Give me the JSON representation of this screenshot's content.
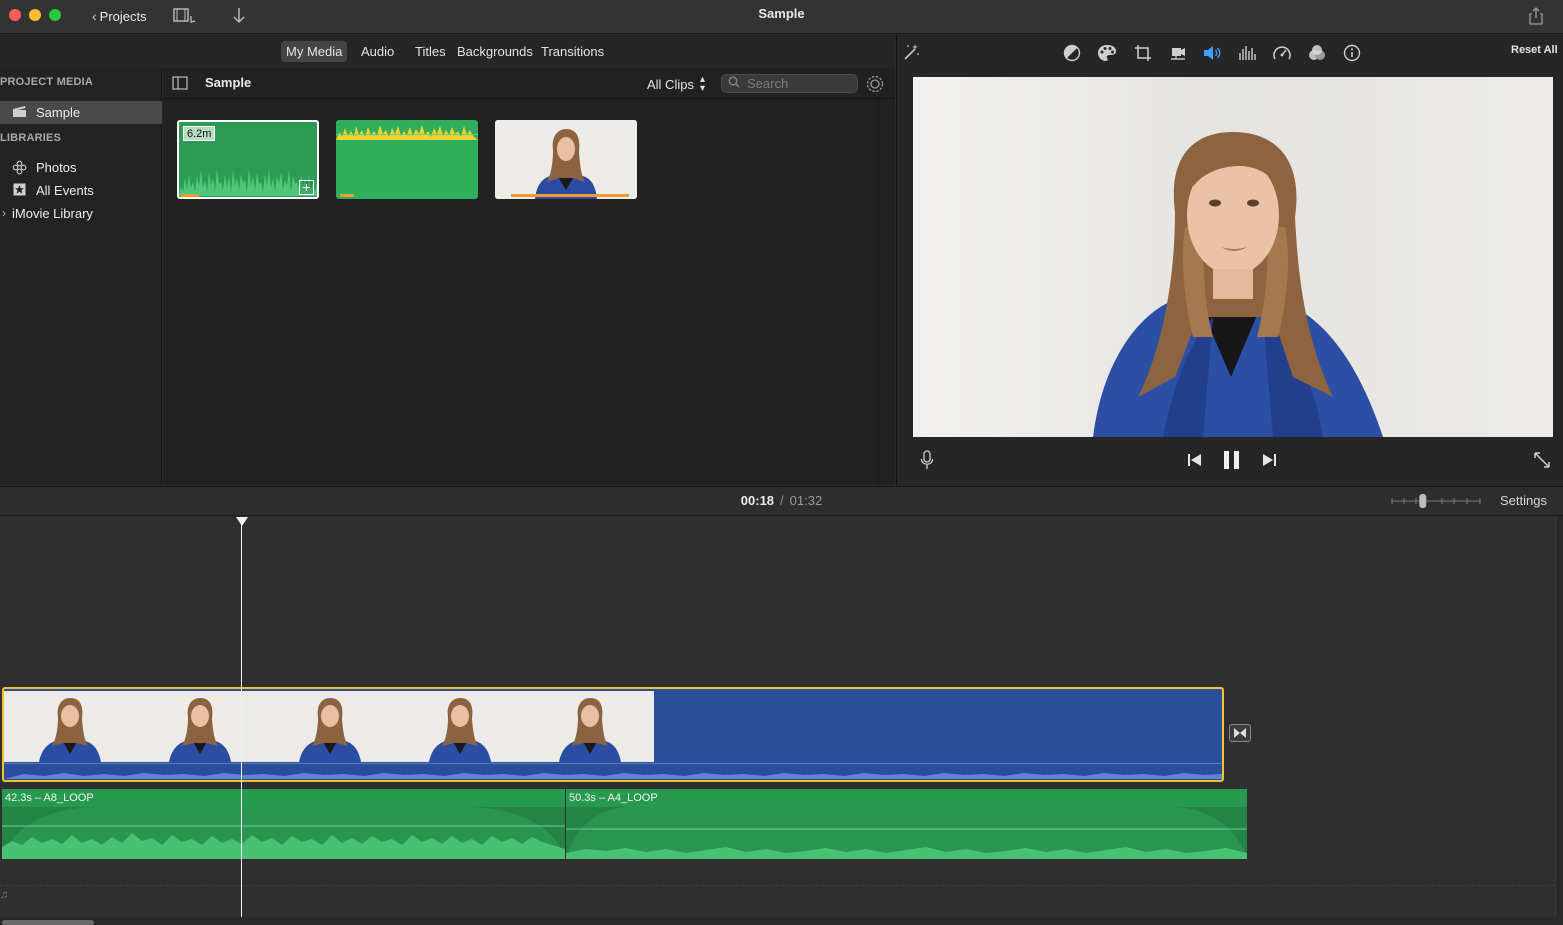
{
  "window": {
    "title": "Sample",
    "projects_label": "Projects"
  },
  "browser_tabs": [
    "My Media",
    "Audio",
    "Titles",
    "Backgrounds",
    "Transitions"
  ],
  "sidebar": {
    "project_media_heading": "PROJECT MEDIA",
    "project_item": "Sample",
    "libraries_heading": "LIBRARIES",
    "library_items": [
      "Photos",
      "All Events",
      "iMovie Library"
    ]
  },
  "browser": {
    "title": "Sample",
    "filter_label": "All Clips",
    "search_placeholder": "Search",
    "clips": [
      {
        "kind": "audio",
        "badge": "6.2m"
      },
      {
        "kind": "audio"
      },
      {
        "kind": "video"
      }
    ]
  },
  "viewer": {
    "reset_label": "Reset All",
    "tool_icons": [
      "magic-wand-icon",
      "color-balance-icon",
      "color-correction-icon",
      "crop-icon",
      "stabilization-icon",
      "volume-icon",
      "noise-reduction-icon",
      "speed-icon",
      "clip-filter-icon",
      "info-icon"
    ]
  },
  "timeline": {
    "current_time": "00:18",
    "separator": "/",
    "total_time": "01:32",
    "settings_label": "Settings",
    "zoom_level": 0.35,
    "playhead_time": "00:18",
    "audio_clips": [
      {
        "label": "42.3s – A8_LOOP"
      },
      {
        "label": "50.3s – A4_LOOP"
      }
    ]
  },
  "colors": {
    "video_clip": "#2a4e99",
    "audio_clip": "#289a50",
    "selection": "#f2c230",
    "progress": "#f29a2e"
  }
}
